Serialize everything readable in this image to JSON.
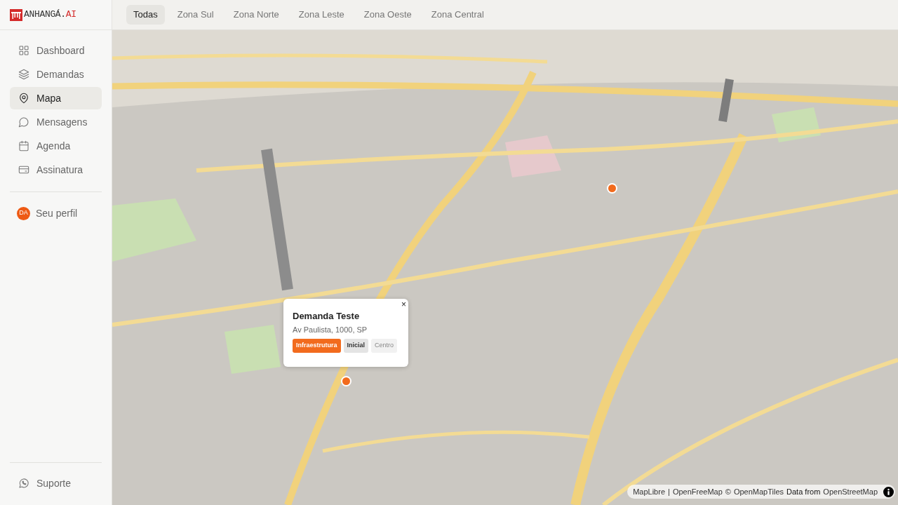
{
  "logo": {
    "name": "ANHANGÁ.",
    "accent": "AI"
  },
  "sidebar": {
    "items": [
      {
        "label": "Dashboard",
        "selected": false
      },
      {
        "label": "Demandas",
        "selected": false
      },
      {
        "label": "Mapa",
        "selected": true
      },
      {
        "label": "Mensagens",
        "selected": false
      },
      {
        "label": "Agenda",
        "selected": false
      },
      {
        "label": "Assinatura",
        "selected": false
      }
    ],
    "profile": {
      "initials": "DA",
      "label": "Seu perfil"
    },
    "footer": {
      "label": "Suporte"
    }
  },
  "tabs": [
    {
      "label": "Todas",
      "selected": true
    },
    {
      "label": "Zona Sul",
      "selected": false
    },
    {
      "label": "Zona Norte",
      "selected": false
    },
    {
      "label": "Zona Leste",
      "selected": false
    },
    {
      "label": "Zona Oeste",
      "selected": false
    },
    {
      "label": "Zona Central",
      "selected": false
    }
  ],
  "map": {
    "popup": {
      "title": "Demanda Teste",
      "address": "Av Paulista, 1000, SP",
      "close": "×",
      "tags": [
        {
          "kind": "category",
          "label": "Infraestrutura"
        },
        {
          "kind": "status",
          "label": "Inicial"
        },
        {
          "kind": "zone",
          "label": "Centro"
        }
      ]
    },
    "attribution": [
      {
        "kind": "link",
        "text": "MapLibre"
      },
      {
        "kind": "text",
        "text": "|"
      },
      {
        "kind": "link",
        "text": "OpenFreeMap"
      },
      {
        "kind": "text",
        "text": "©"
      },
      {
        "kind": "link",
        "text": "OpenMapTiles"
      },
      {
        "kind": "strong",
        "text": "Data from"
      },
      {
        "kind": "link",
        "text": "OpenStreetMap"
      }
    ]
  }
}
